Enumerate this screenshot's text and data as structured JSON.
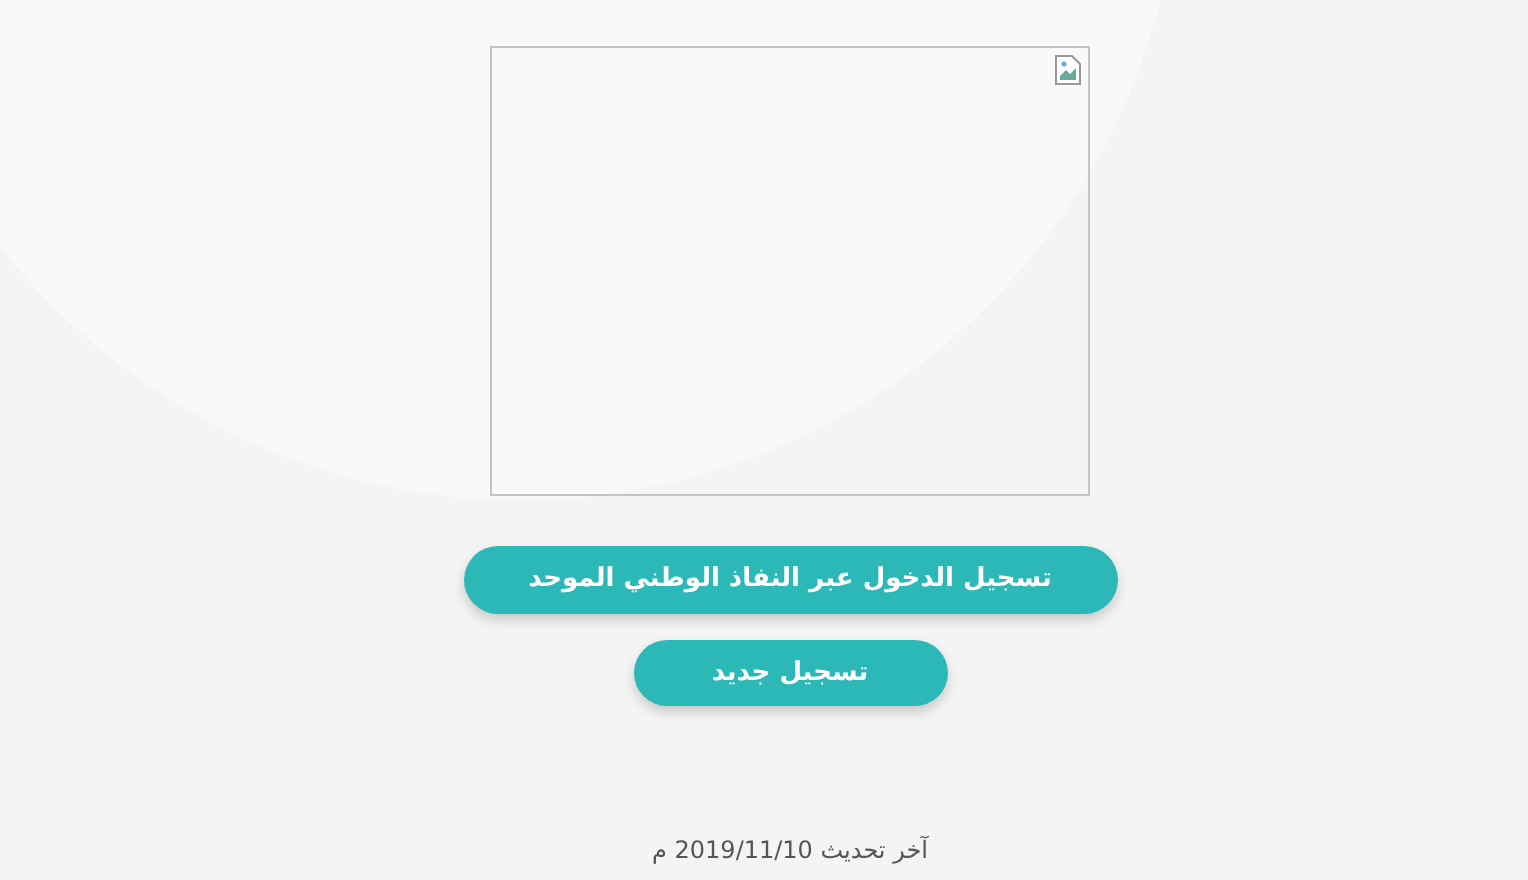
{
  "image": {
    "kind": "broken_image"
  },
  "buttons": [
    {
      "label": "تسجيل الدخول عبر النفاذ الوطني الموحد"
    },
    {
      "label": "تسجيل جديد"
    }
  ],
  "footer": {
    "text": "آخر تحديث 2019/11/10 م"
  }
}
